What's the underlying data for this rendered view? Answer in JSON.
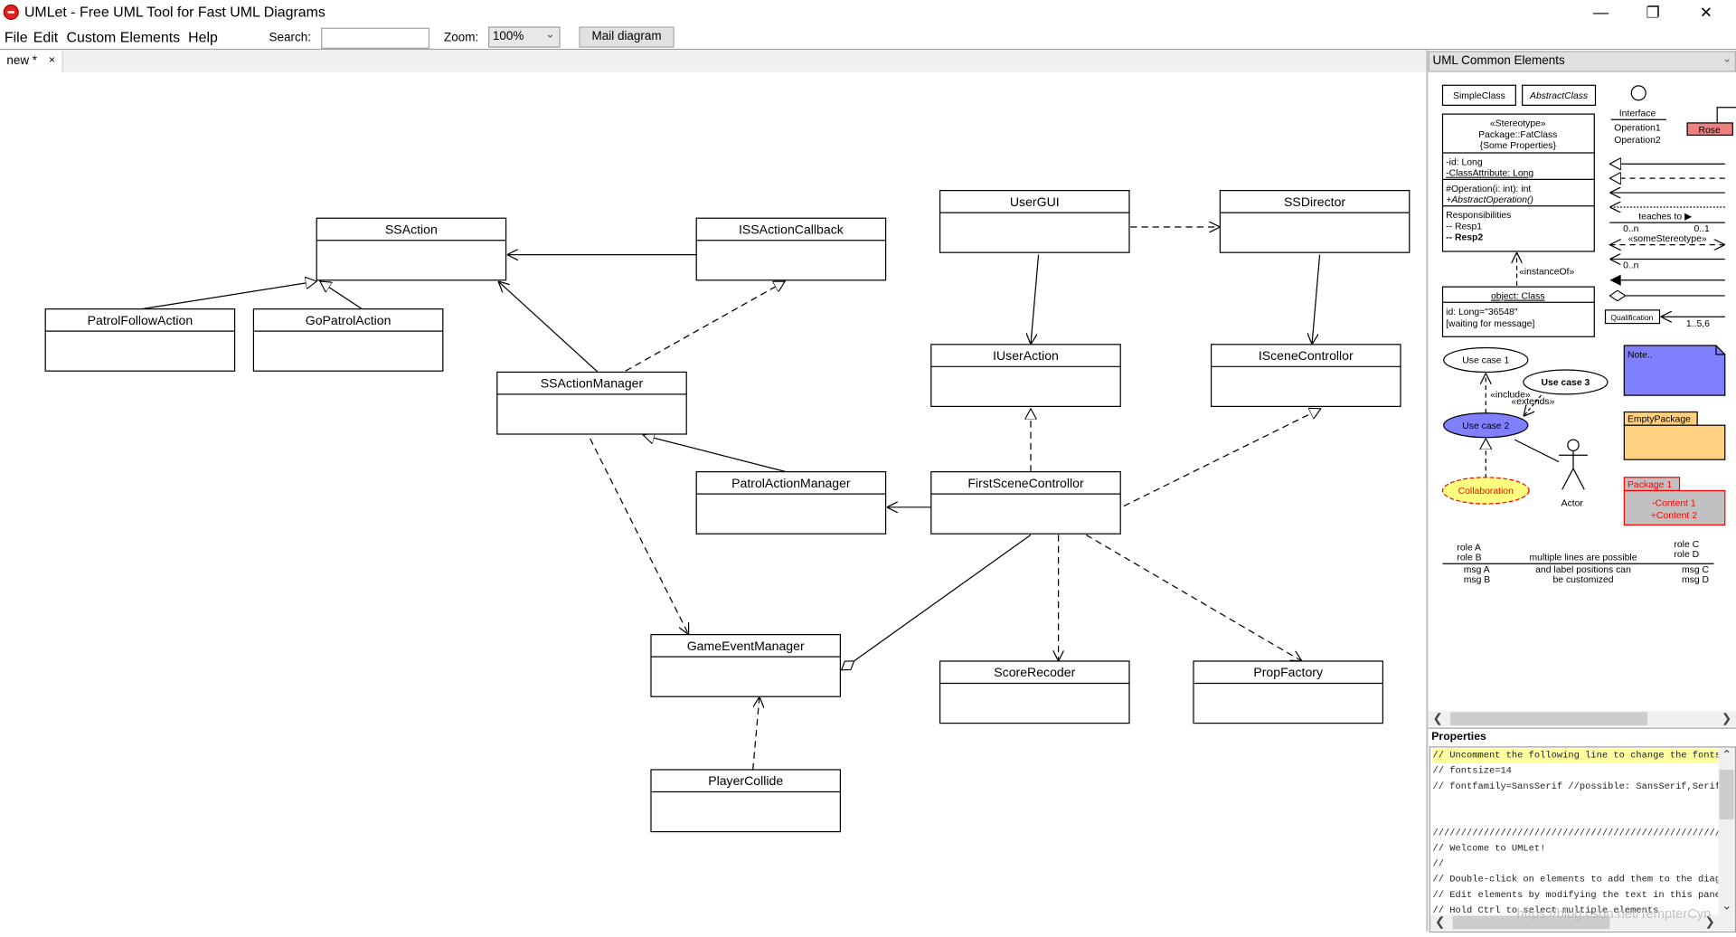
{
  "window": {
    "title": "UMLet - Free UML Tool for Fast UML Diagrams",
    "minimize_icon": "minimize-icon",
    "restore_icon": "restore-icon",
    "close_icon": "close-icon"
  },
  "menu": {
    "items": [
      "File",
      "Edit",
      "Custom Elements",
      "Help"
    ]
  },
  "toolbar": {
    "search_label": "Search:",
    "search_value": "",
    "zoom_label": "Zoom:",
    "zoom_value": "100%",
    "mail_button": "Mail diagram"
  },
  "tabs": [
    {
      "label": "new *",
      "close": "×"
    }
  ],
  "diagram": {
    "classes": [
      "SSAction",
      "ISSActionCallback",
      "PatrolFollowAction",
      "GoPatrolAction",
      "SSActionManager",
      "UserGUI",
      "SSDirector",
      "IUserAction",
      "ISceneControllor",
      "PatrolActionManager",
      "FirstSceneControllor",
      "GameEventManager",
      "ScoreRecoder",
      "PropFactory",
      "PlayerCollide"
    ]
  },
  "palette": {
    "title": "UML Common Elements",
    "simple_class": "SimpleClass",
    "abstract_class": "AbstractClass",
    "interface": {
      "name": "Interface",
      "op1": "Operation1",
      "op2": "Operation2"
    },
    "rose": "Rose",
    "fat_class": {
      "stereotype": "«Stereotype»",
      "name": "Package::FatClass",
      "props": "{Some Properties}",
      "attr1": "-id: Long",
      "attr2": "-ClassAttribute: Long",
      "op1": "#Operation(i: int): int",
      "op2": "+AbstractOperation()",
      "resp": "Responsibilities",
      "resp1": "-- Resp1",
      "resp2": "-- Resp2"
    },
    "instance_of": "«instanceOf»",
    "object": {
      "name": "object: Class",
      "line1": "id: Long=\"36548\"",
      "line2": "[waiting for message]"
    },
    "teaches": "teaches to ▶",
    "mult_0n": "0..n",
    "mult_01": "0..1",
    "some_stereotype": "«someStereotype»",
    "mult_0n_2": "0..n",
    "qualification": "Qualification",
    "mult_156": "1..5,6",
    "usecase1": "Use case 1",
    "usecase2": "Use case 2",
    "usecase3": "Use case 3",
    "include": "«include»",
    "extends": "«extends»",
    "actor": "Actor",
    "collaboration": "Collaboration",
    "note": "Note..",
    "empty_package": "EmptyPackage",
    "package1": {
      "name": "Package 1",
      "c1": "-Content 1",
      "c2": "+Content 2"
    },
    "seq": {
      "roleA": "role A",
      "roleB": "role B",
      "roleC": "role C",
      "roleD": "role D",
      "mid1": "multiple lines are possible",
      "mid2": "and label positions can",
      "mid3": "be customized",
      "msgA": "msg A",
      "msgB": "msg B",
      "msgC": "msg C",
      "msgD": "msg D"
    },
    "colors": {
      "rose": "#f08080",
      "usecase2": "#8080ff",
      "note": "#8080ff",
      "collaboration": "#ffff80",
      "empty_package": "#ffd080",
      "package1": "#c0c0c0",
      "red": "#ff0000"
    }
  },
  "properties": {
    "label": "Properties",
    "lines": [
      "// Uncomment the following line to change the fontsize and font:",
      "// fontsize=14",
      "// fontfamily=SansSerif //possible: SansSerif,Serif,Monospaced",
      "",
      "",
      "//////////////////////////////////////////////////////////////////////",
      "// Welcome to UMLet!",
      "//",
      "// Double-click on elements to add them to the diagram, or to copy them",
      "// Edit elements by modifying the text in this panel",
      "// Hold Ctrl to select multiple elements"
    ]
  },
  "watermark": "https://blog.csdn.net/TempterCyn"
}
